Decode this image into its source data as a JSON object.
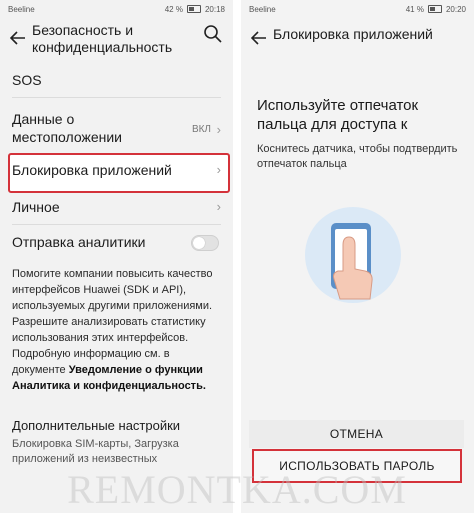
{
  "left": {
    "status": {
      "carrier": "Beeline",
      "battery": "42 %",
      "time": "20:18"
    },
    "title": "Безопасность и конфиденциальность",
    "items": {
      "sos": "SOS",
      "location": "Данные о местоположении",
      "location_value": "ВКЛ",
      "applock": "Блокировка приложений",
      "personal": "Личное",
      "analytics": "Отправка аналитики"
    },
    "paragraph": {
      "text": "Помогите компании повысить качество интерфейсов Huawei (SDK и API), используемых другими приложениями. Разрешите анализировать статистику использования этих интерфейсов. Подробную информацию см. в документе ",
      "link": "Уведомление о функции Аналитика и конфиденциальность."
    },
    "advanced": {
      "title": "Дополнительные настройки",
      "sub": "Блокировка SIM-карты, Загрузка приложений из неизвестных"
    }
  },
  "right": {
    "status": {
      "carrier": "Beeline",
      "battery": "41 %",
      "time": "20:20"
    },
    "title": "Блокировка приложений",
    "heading": "Используйте отпечаток пальца для доступа к",
    "subtext": "Коснитесь датчика, чтобы подтвердить отпечаток пальца",
    "cancel_label": "ОТМЕНА",
    "use_password_label": "ИСПОЛЬЗОВАТЬ ПАРОЛЬ"
  },
  "watermark": "REMONTKA.COM",
  "colors": {
    "highlight": "#d4323a",
    "background": "#f2f2f2"
  }
}
